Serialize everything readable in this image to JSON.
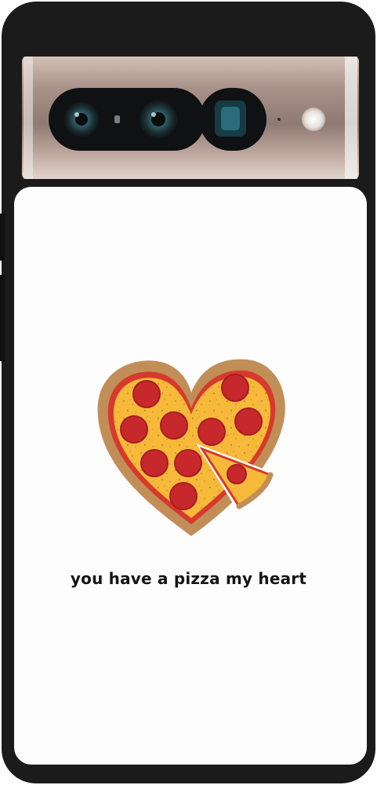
{
  "product": {
    "tagline": "you have a pizza my heart",
    "illustration": "heart-shaped-pepperoni-pizza",
    "case_color": "#1b1b1b",
    "back_color": "#fdfdfd",
    "camera_bar_color": "#b79f96"
  },
  "pizza": {
    "crust_color": "#c28e58",
    "cheese_color": "#f6b93a",
    "sauce_color": "#d63a2c",
    "pepperoni_color": "#c7282b"
  }
}
